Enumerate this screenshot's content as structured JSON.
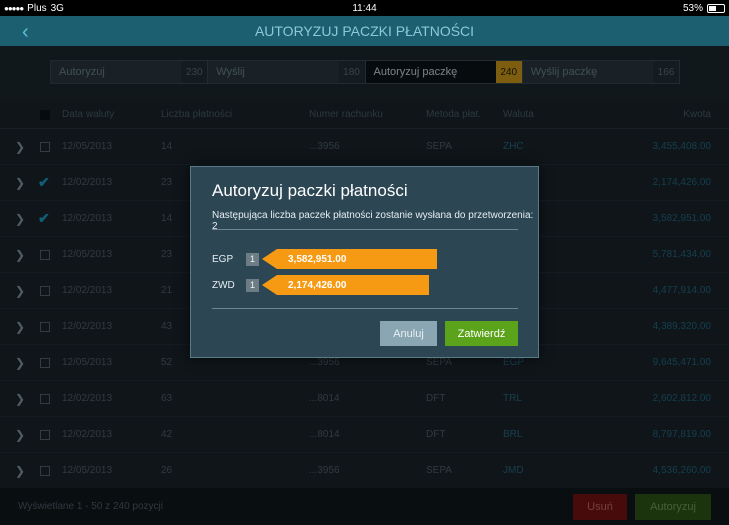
{
  "status_bar": {
    "signal_dots": "●●●●●",
    "carrier": "Plus",
    "network": "3G",
    "time": "11:44",
    "battery_text": "53%",
    "battery_level": 0.53
  },
  "header": {
    "back_icon": "‹",
    "title": "AUTORYZUJ PACZKI PŁATNOŚCI"
  },
  "tabs": [
    {
      "label": "Autoryzuj",
      "count": "230",
      "active": false
    },
    {
      "label": "Wyślij",
      "count": "180",
      "active": false
    },
    {
      "label": "Autoryzuj paczkę",
      "count": "240",
      "active": true
    },
    {
      "label": "Wyślij paczkę",
      "count": "166",
      "active": false
    }
  ],
  "table": {
    "columns": {
      "date": "Data waluty",
      "count": "Liczba płatności",
      "account": "Numer rachunku",
      "method": "Metoda płat.",
      "currency": "Waluta",
      "amount": "Kwota"
    },
    "rows": [
      {
        "checked": false,
        "date": "12/05/2013",
        "count": "14",
        "account": "...3956",
        "method": "SEPA",
        "currency": "ZHC",
        "amount": "3,455,408.00"
      },
      {
        "checked": true,
        "date": "12/02/2013",
        "count": "23",
        "account": "",
        "method": "",
        "currency": "",
        "amount": "2,174,426.00"
      },
      {
        "checked": true,
        "date": "12/02/2013",
        "count": "14",
        "account": "",
        "method": "",
        "currency": "",
        "amount": "3,582,951.00"
      },
      {
        "checked": false,
        "date": "12/05/2013",
        "count": "23",
        "account": "",
        "method": "",
        "currency": "",
        "amount": "5,781,434.00"
      },
      {
        "checked": false,
        "date": "12/02/2013",
        "count": "21",
        "account": "",
        "method": "",
        "currency": "",
        "amount": "4,477,914.00"
      },
      {
        "checked": false,
        "date": "12/02/2013",
        "count": "43",
        "account": "",
        "method": "",
        "currency": "",
        "amount": "4,389,320.00"
      },
      {
        "checked": false,
        "date": "12/05/2013",
        "count": "52",
        "account": "...3956",
        "method": "SEPA",
        "currency": "EGP",
        "amount": "9,645,471.00"
      },
      {
        "checked": false,
        "date": "12/02/2013",
        "count": "63",
        "account": "...8014",
        "method": "DFT",
        "currency": "TRL",
        "amount": "2,602,812.00"
      },
      {
        "checked": false,
        "date": "12/02/2013",
        "count": "42",
        "account": "...8014",
        "method": "DFT",
        "currency": "BRL",
        "amount": "8,797,819.00"
      },
      {
        "checked": false,
        "date": "12/05/2013",
        "count": "26",
        "account": "...3956",
        "method": "SEPA",
        "currency": "JMD",
        "amount": "4,536,260.00"
      }
    ]
  },
  "footer": {
    "info": "Wyświetlane 1 - 50 z 240 pozycji",
    "delete_label": "Usuń",
    "authorize_label": "Autoryzuj"
  },
  "dialog": {
    "title": "Autoryzuj paczki płatności",
    "message": "Następująca liczba paczek płatności zostanie wysłana do przetworzenia: 2",
    "payments": [
      {
        "currency": "EGP",
        "badge": "1",
        "amount": "3,582,951.00"
      },
      {
        "currency": "ZWD",
        "badge": "1",
        "amount": "2,174,426.00"
      }
    ],
    "cancel_label": "Anuluj",
    "confirm_label": "Zatwierdź"
  },
  "colors": {
    "accent_orange": "#f79a13",
    "confirm_green": "#5aa31a",
    "header_teal": "#1b5f70",
    "active_count_gold": "#d8a31c",
    "delete_red": "#7a1313"
  }
}
